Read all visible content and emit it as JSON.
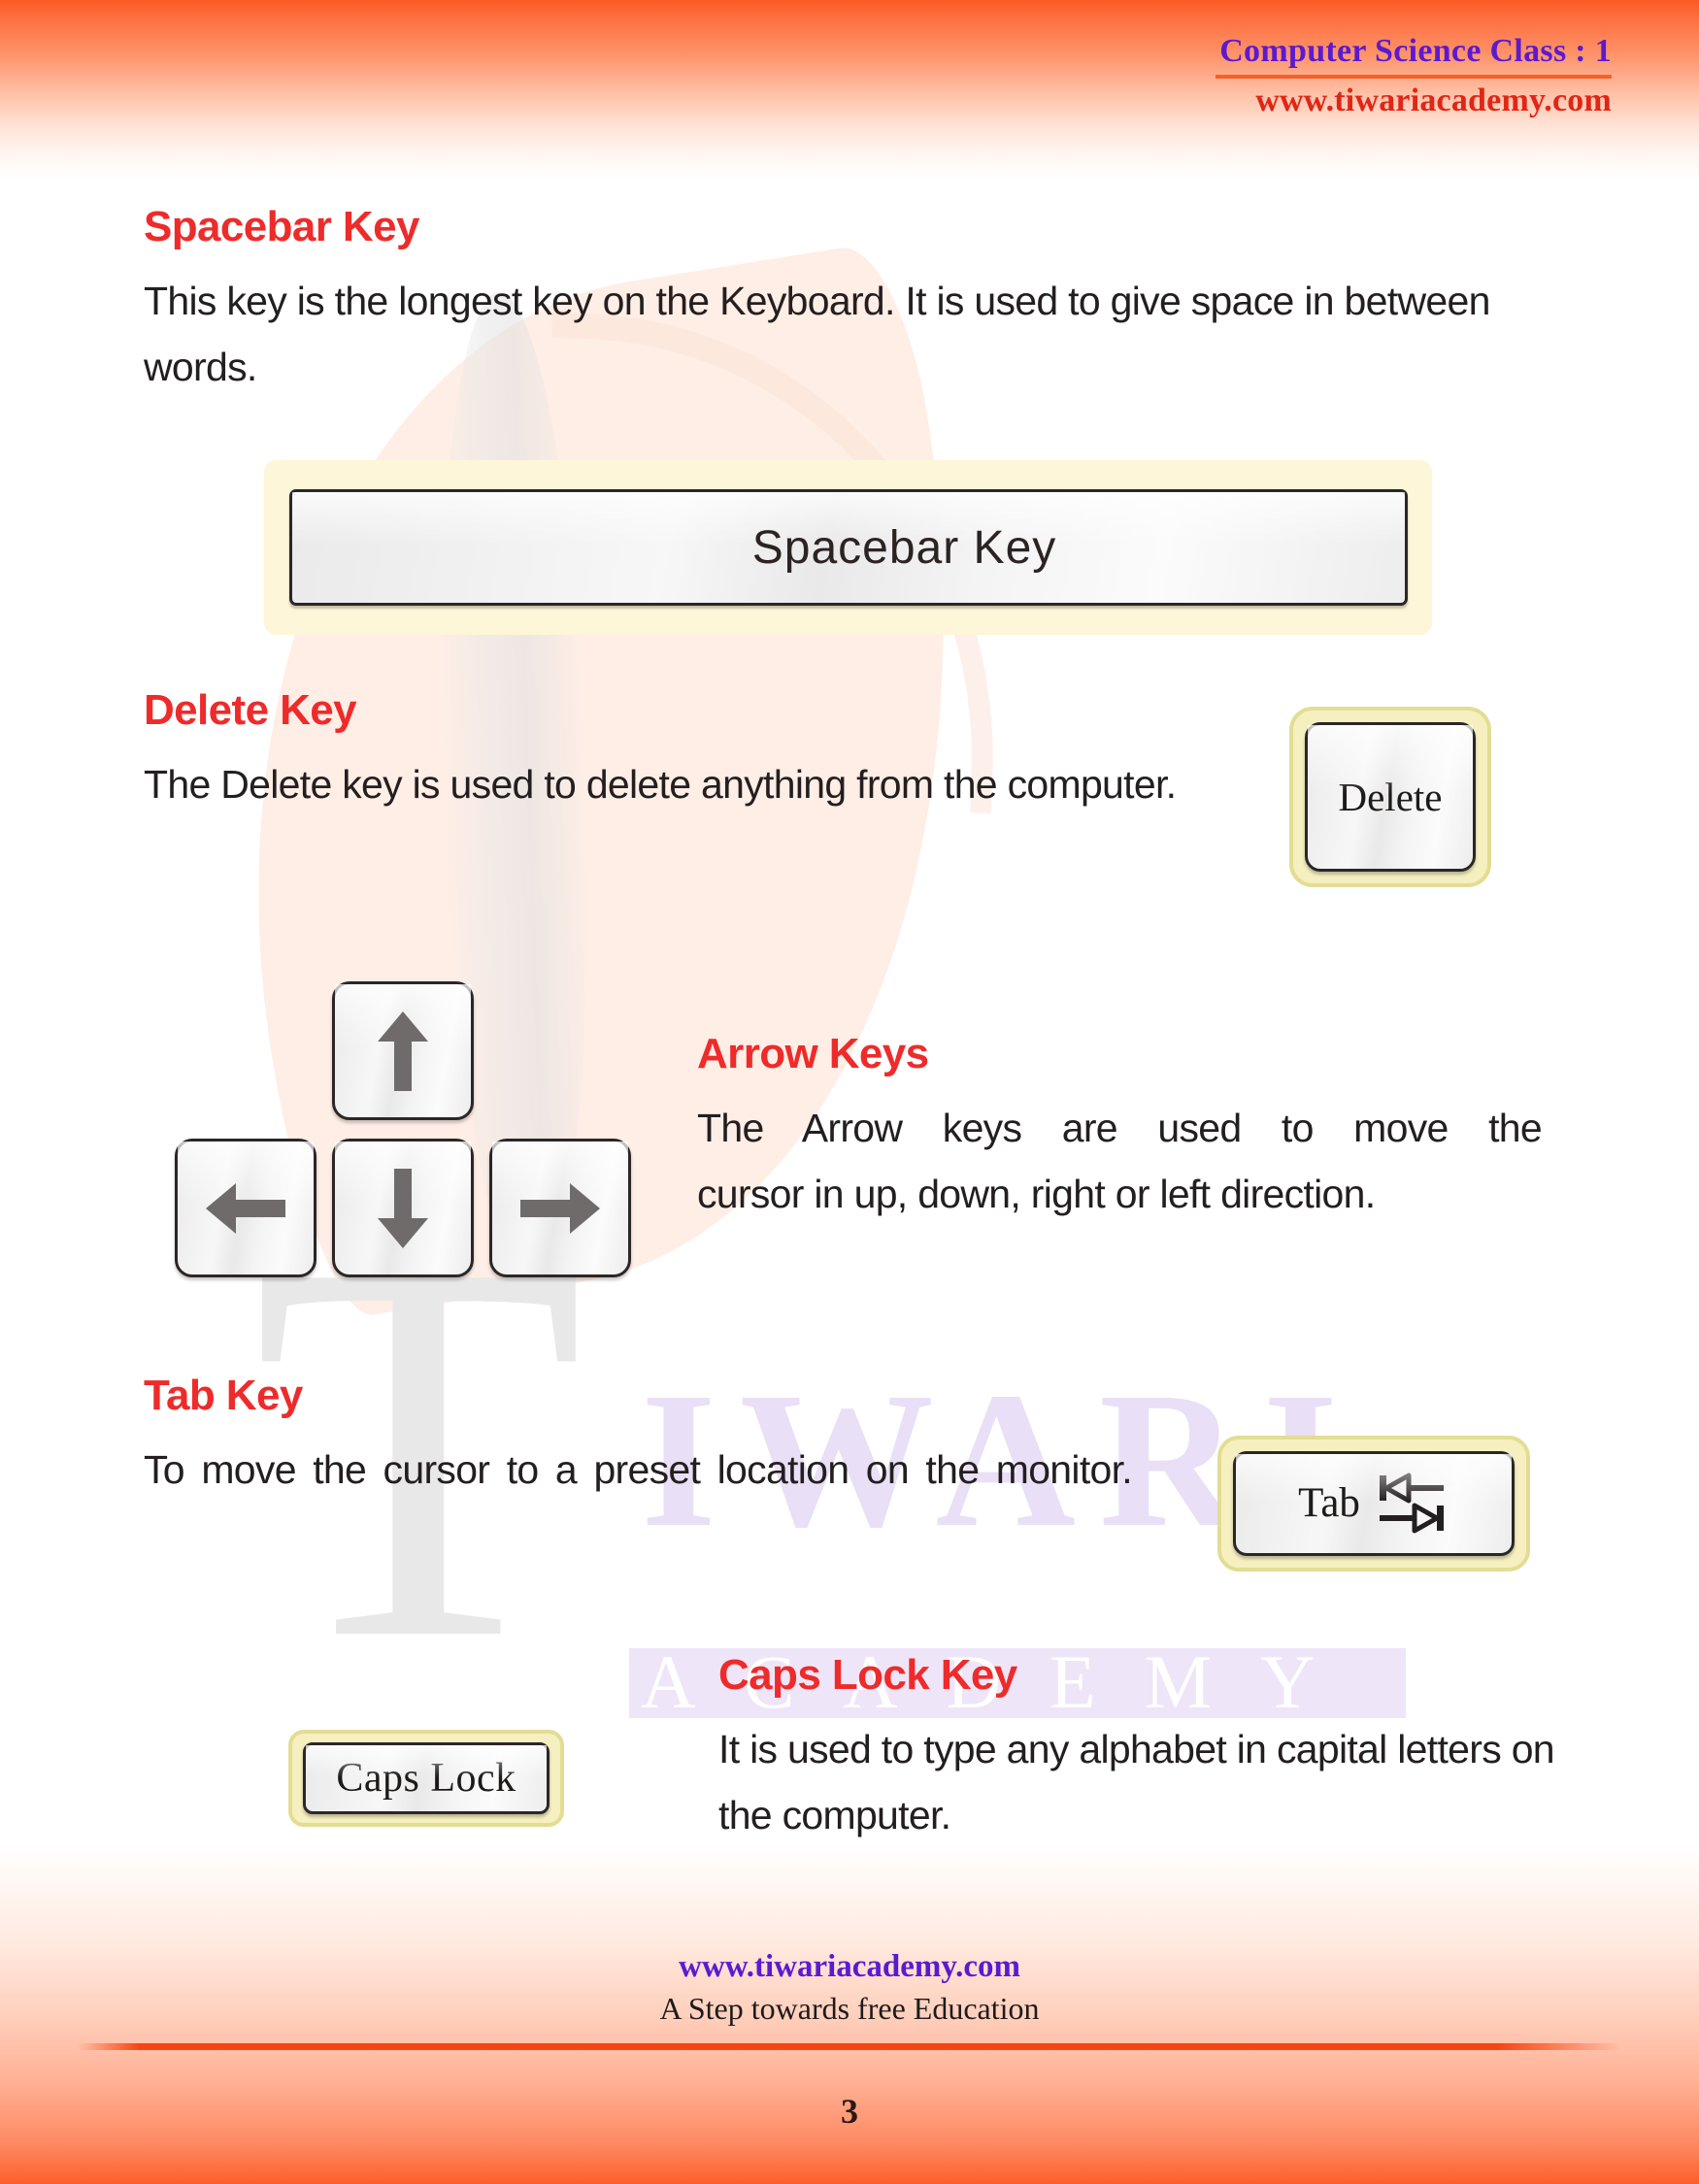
{
  "header": {
    "title": "Computer Science Class : 1",
    "url": "www.tiwariacademy.com"
  },
  "watermark": {
    "letter": "T",
    "word": "IWARI",
    "subword": "ACADEMY"
  },
  "sections": [
    {
      "id": "spacebar",
      "heading": "Spacebar Key",
      "body": "This key is the longest key on the Keyboard. It is used to give space in between words.",
      "key_label": "Spacebar Key"
    },
    {
      "id": "delete",
      "heading": "Delete Key",
      "body": "The Delete key is used to delete anything from the computer.",
      "key_label": "Delete"
    },
    {
      "id": "arrow",
      "heading": "Arrow Keys",
      "body_line1": "The Arrow  keys are used to move the",
      "body_line2": "cursor in up, down, right or left direction.",
      "keys": [
        {
          "name": "up",
          "glyph": "↑"
        },
        {
          "name": "left",
          "glyph": "←"
        },
        {
          "name": "down",
          "glyph": "↓"
        },
        {
          "name": "right",
          "glyph": "→"
        }
      ]
    },
    {
      "id": "tab",
      "heading": "Tab Key",
      "body": "To move the cursor to a preset location on the monitor.",
      "key_label": "Tab"
    },
    {
      "id": "capslock",
      "heading": "Caps Lock Key",
      "body": "It is used to type any alphabet in capital letters on the computer.",
      "key_label": "Caps Lock"
    }
  ],
  "footer": {
    "url": "www.tiwariacademy.com",
    "tagline": "A Step towards free Education",
    "page_number": "3"
  },
  "colors": {
    "heading_red": "#ee2b2b",
    "header_purple": "#5c1ad0",
    "header_url_red": "#e02617",
    "accent_orange": "#f44612",
    "key_bezel_yellow": "#f6f0c0",
    "body_text": "#231f20"
  }
}
